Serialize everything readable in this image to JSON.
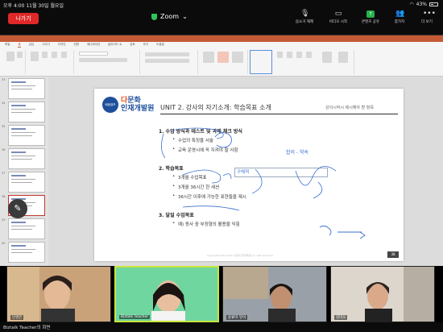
{
  "status": {
    "time": "오후 4:00",
    "date": "11월 30일 월요일",
    "battery": "43%"
  },
  "zoom": {
    "leave_label": "나가기",
    "title": "Zoom",
    "controls": [
      {
        "label": "음소거 해제",
        "icon": "mic-off-icon"
      },
      {
        "label": "비디오 시작",
        "icon": "video-off-icon"
      },
      {
        "label": "콘텐츠 공유",
        "icon": "share-icon"
      },
      {
        "label": "참가자",
        "icon": "participants-icon"
      },
      {
        "label": "더 보기",
        "icon": "more-icon"
      }
    ]
  },
  "ppt": {
    "menu_tabs": [
      "파일",
      "홈",
      "삽입",
      "그리기",
      "디자인",
      "전환",
      "애니메이션",
      "슬라이드 쇼",
      "검토",
      "보기",
      "도움말"
    ],
    "thumb_numbers": [
      "33",
      "34",
      "35",
      "36",
      "37",
      "38",
      "39",
      "40"
    ],
    "canvas_slide_number": "38"
  },
  "slide": {
    "logo_badge": "배움캠프",
    "logo_line1_a": "다",
    "logo_line1_b": "문화",
    "logo_line2": "인재개발원",
    "title": "UNIT 2. 강사의 자기소개: 학습목표 소개",
    "subtitle": "강의시작시 제시해야 할 항목",
    "section1": "1.  수업 방식과 테스트 및 과제 체크 방식",
    "s1_b1": "수업의 특징을 서술",
    "s1_b2": "교육 운영시에 꼭 지켜야 할 사항",
    "section2": "2.  학습목표",
    "s2_b1": "3개월 수업목표",
    "s2_b2": "3개월 36시간 한 세션",
    "s2_b3": "36시간 이후에 가능한 표현들을 제시",
    "section3": "3.  달일 수업목표",
    "s3_b1": "예) 동사 중 부정형의 활용을 익힘",
    "handwriting_1": "합의 - 약속",
    "inputbox_text": "구체적",
    "footer": "Copyright 2020-2021 다문화인재개발원 All right reserved",
    "page_number": "38"
  },
  "videos": [
    {
      "name": "안경은"
    },
    {
      "name": "Biztalk Teacher"
    },
    {
      "name": "윤류미 뮤이"
    },
    {
      "name": "김미오"
    }
  ],
  "bottom_label": "Biztalk Teacher의 화면"
}
